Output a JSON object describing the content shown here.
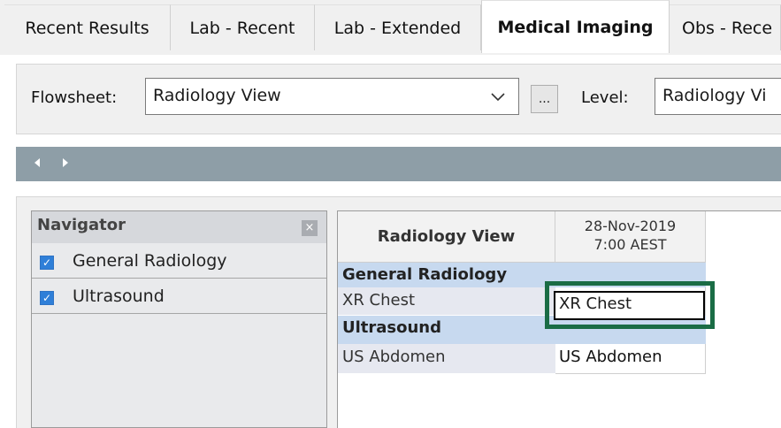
{
  "tabs": [
    {
      "label": "Recent Results",
      "active": false
    },
    {
      "label": "Lab - Recent",
      "active": false
    },
    {
      "label": "Lab - Extended",
      "active": false
    },
    {
      "label": "Medical Imaging",
      "active": true
    },
    {
      "label": "Obs - Rece",
      "active": false
    }
  ],
  "toolbar": {
    "flowsheet_label": "Flowsheet:",
    "flowsheet_value": "Radiology View",
    "ellipsis_label": "...",
    "level_label": "Level:",
    "level_value": "Radiology Vi"
  },
  "navigator": {
    "title": "Navigator",
    "close_glyph": "×",
    "items": [
      {
        "label": "General Radiology",
        "checked": true
      },
      {
        "label": "Ultrasound",
        "checked": true
      }
    ]
  },
  "grid": {
    "header_label": "Radiology View",
    "date_line1": "28-Nov-2019",
    "date_line2": "7:00 AEST",
    "groups": [
      {
        "name": "General Radiology",
        "rows": [
          {
            "label": "XR Chest",
            "value": "XR Chest"
          }
        ]
      },
      {
        "name": "Ultrasound",
        "rows": [
          {
            "label": "US Abdomen",
            "value": "US Abdomen"
          }
        ]
      }
    ]
  },
  "colors": {
    "highlight_border": "#1a6c45",
    "group_row": "#c7d9ef",
    "strip": "#8e9ea7",
    "checkbox": "#2f7fd8"
  }
}
